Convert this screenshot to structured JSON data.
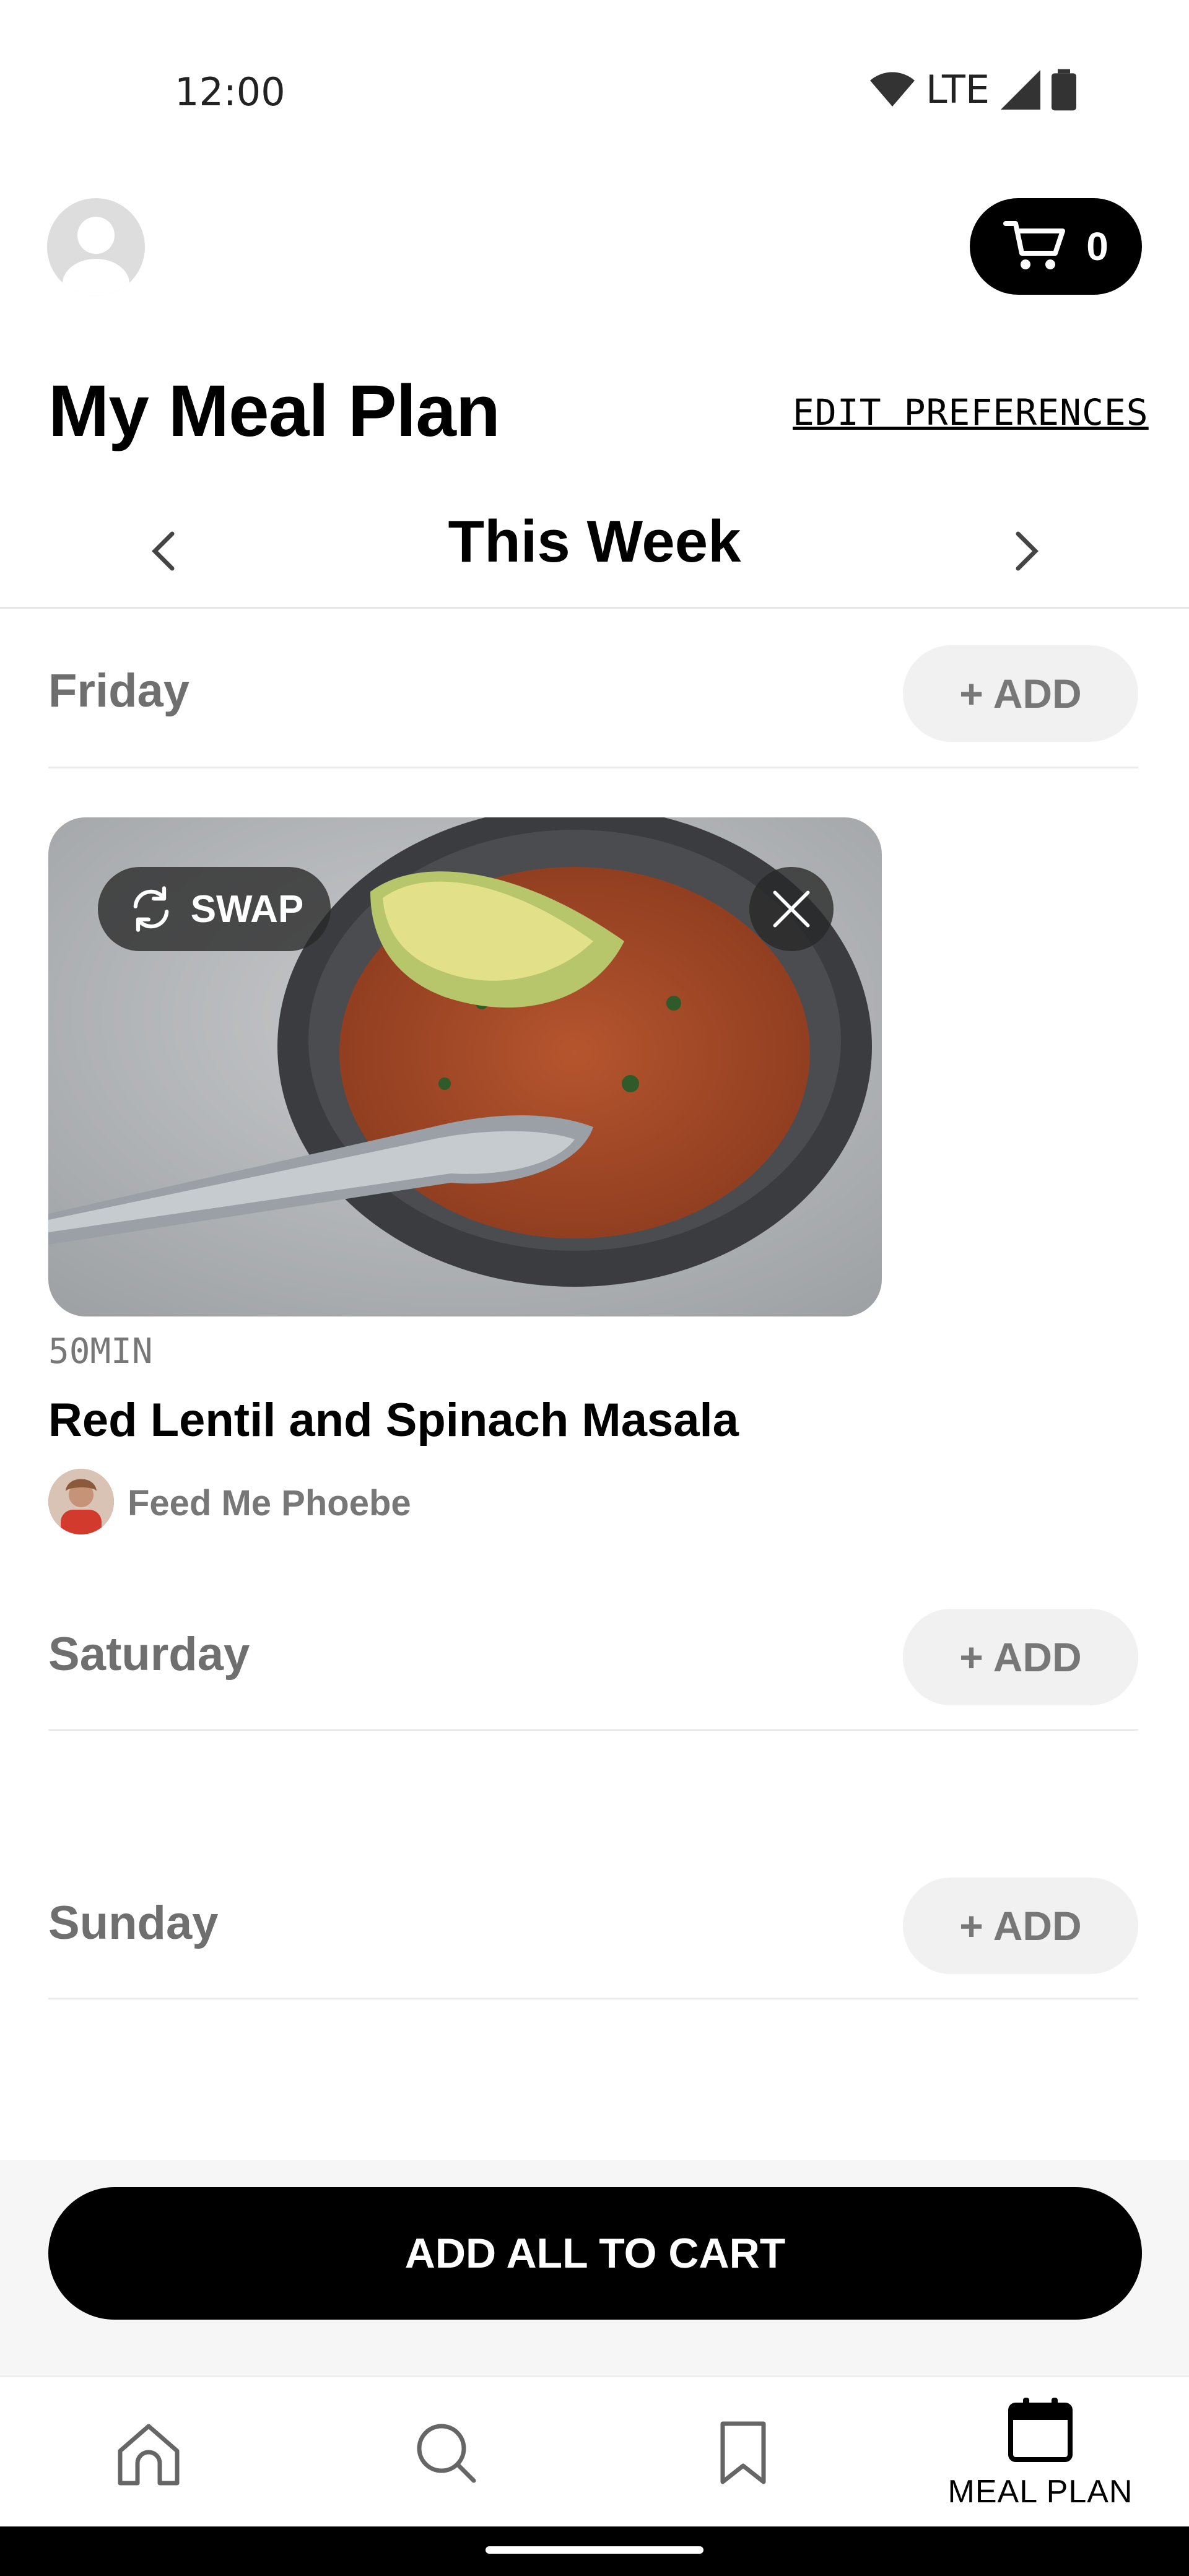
{
  "status_bar": {
    "time": "12:00",
    "network": "LTE"
  },
  "header": {
    "cart_count": "0",
    "title": "My Meal Plan",
    "edit_preferences": "EDIT PREFERENCES"
  },
  "week_nav": {
    "title": "This Week"
  },
  "days": [
    {
      "label": "Friday",
      "add_label": "+ ADD"
    },
    {
      "label": "Saturday",
      "add_label": "+ ADD"
    },
    {
      "label": "Sunday",
      "add_label": "+ ADD"
    }
  ],
  "meal": {
    "swap_label": "SWAP",
    "time": "50MIN",
    "title": "Red Lentil and Spinach Masala",
    "author": "Feed Me Phoebe"
  },
  "cta": {
    "label": "ADD ALL TO CART"
  },
  "bottom_nav": {
    "items": [
      {
        "icon": "home-icon",
        "label": ""
      },
      {
        "icon": "search-icon",
        "label": ""
      },
      {
        "icon": "bookmark-icon",
        "label": ""
      },
      {
        "icon": "calendar-icon",
        "label": "MEAL PLAN"
      }
    ]
  },
  "colors": {
    "primary": "#000000",
    "muted_text": "#6f6f6f",
    "add_button_bg": "#f1f1f1",
    "cta_area_bg": "#f6f6f6"
  }
}
